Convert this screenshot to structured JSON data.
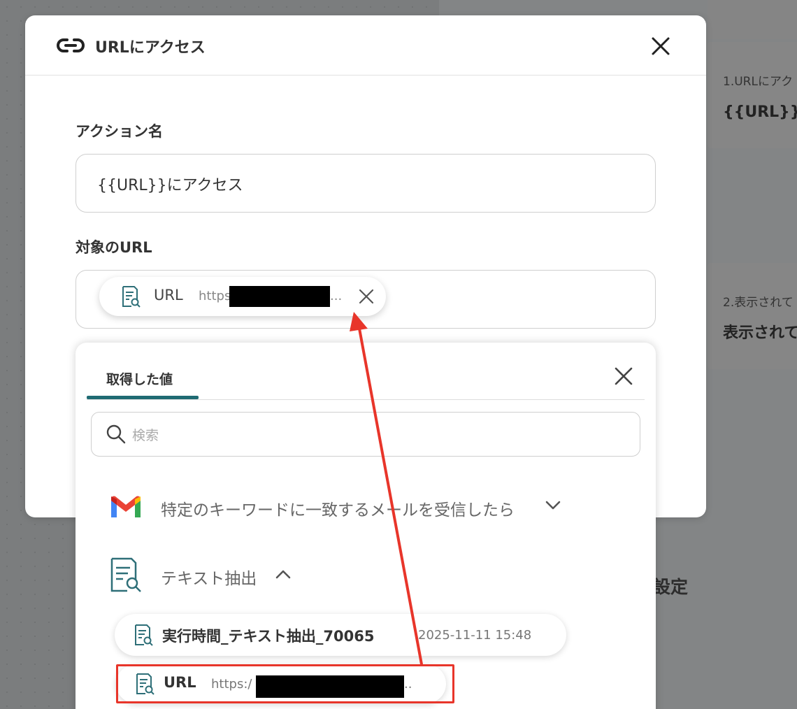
{
  "background": {
    "card1_small": "1.URLにアク",
    "card1_big": "{{URL}}に",
    "card2_small": "2.表示されて",
    "card2_big": "表示されて",
    "setting_text": "設定"
  },
  "modal": {
    "title": "URLにアクセス",
    "action_name_label": "アクション名",
    "action_name_value": "{{URL}}にアクセス",
    "target_url_label": "対象のURL",
    "selected_chip": {
      "label": "URL",
      "value_prefix": "https:",
      "value_suffix": "..."
    }
  },
  "dropdown": {
    "tab_label": "取得した値",
    "search_placeholder": "検索",
    "groups": [
      {
        "label": "特定のキーワードに一致するメールを受信したら",
        "icon": "gmail-icon",
        "expanded": false
      },
      {
        "label": "テキスト抽出",
        "icon": "document-search-icon",
        "expanded": true
      }
    ],
    "items": [
      {
        "label": "実行時間_テキスト抽出_70065",
        "value": "2025-11-11 15:48"
      },
      {
        "label": "URL",
        "value_prefix": "https:/",
        "value_suffix": ".."
      }
    ]
  },
  "colors": {
    "accent": "#1f6b73",
    "annotation": "#e8352a"
  }
}
